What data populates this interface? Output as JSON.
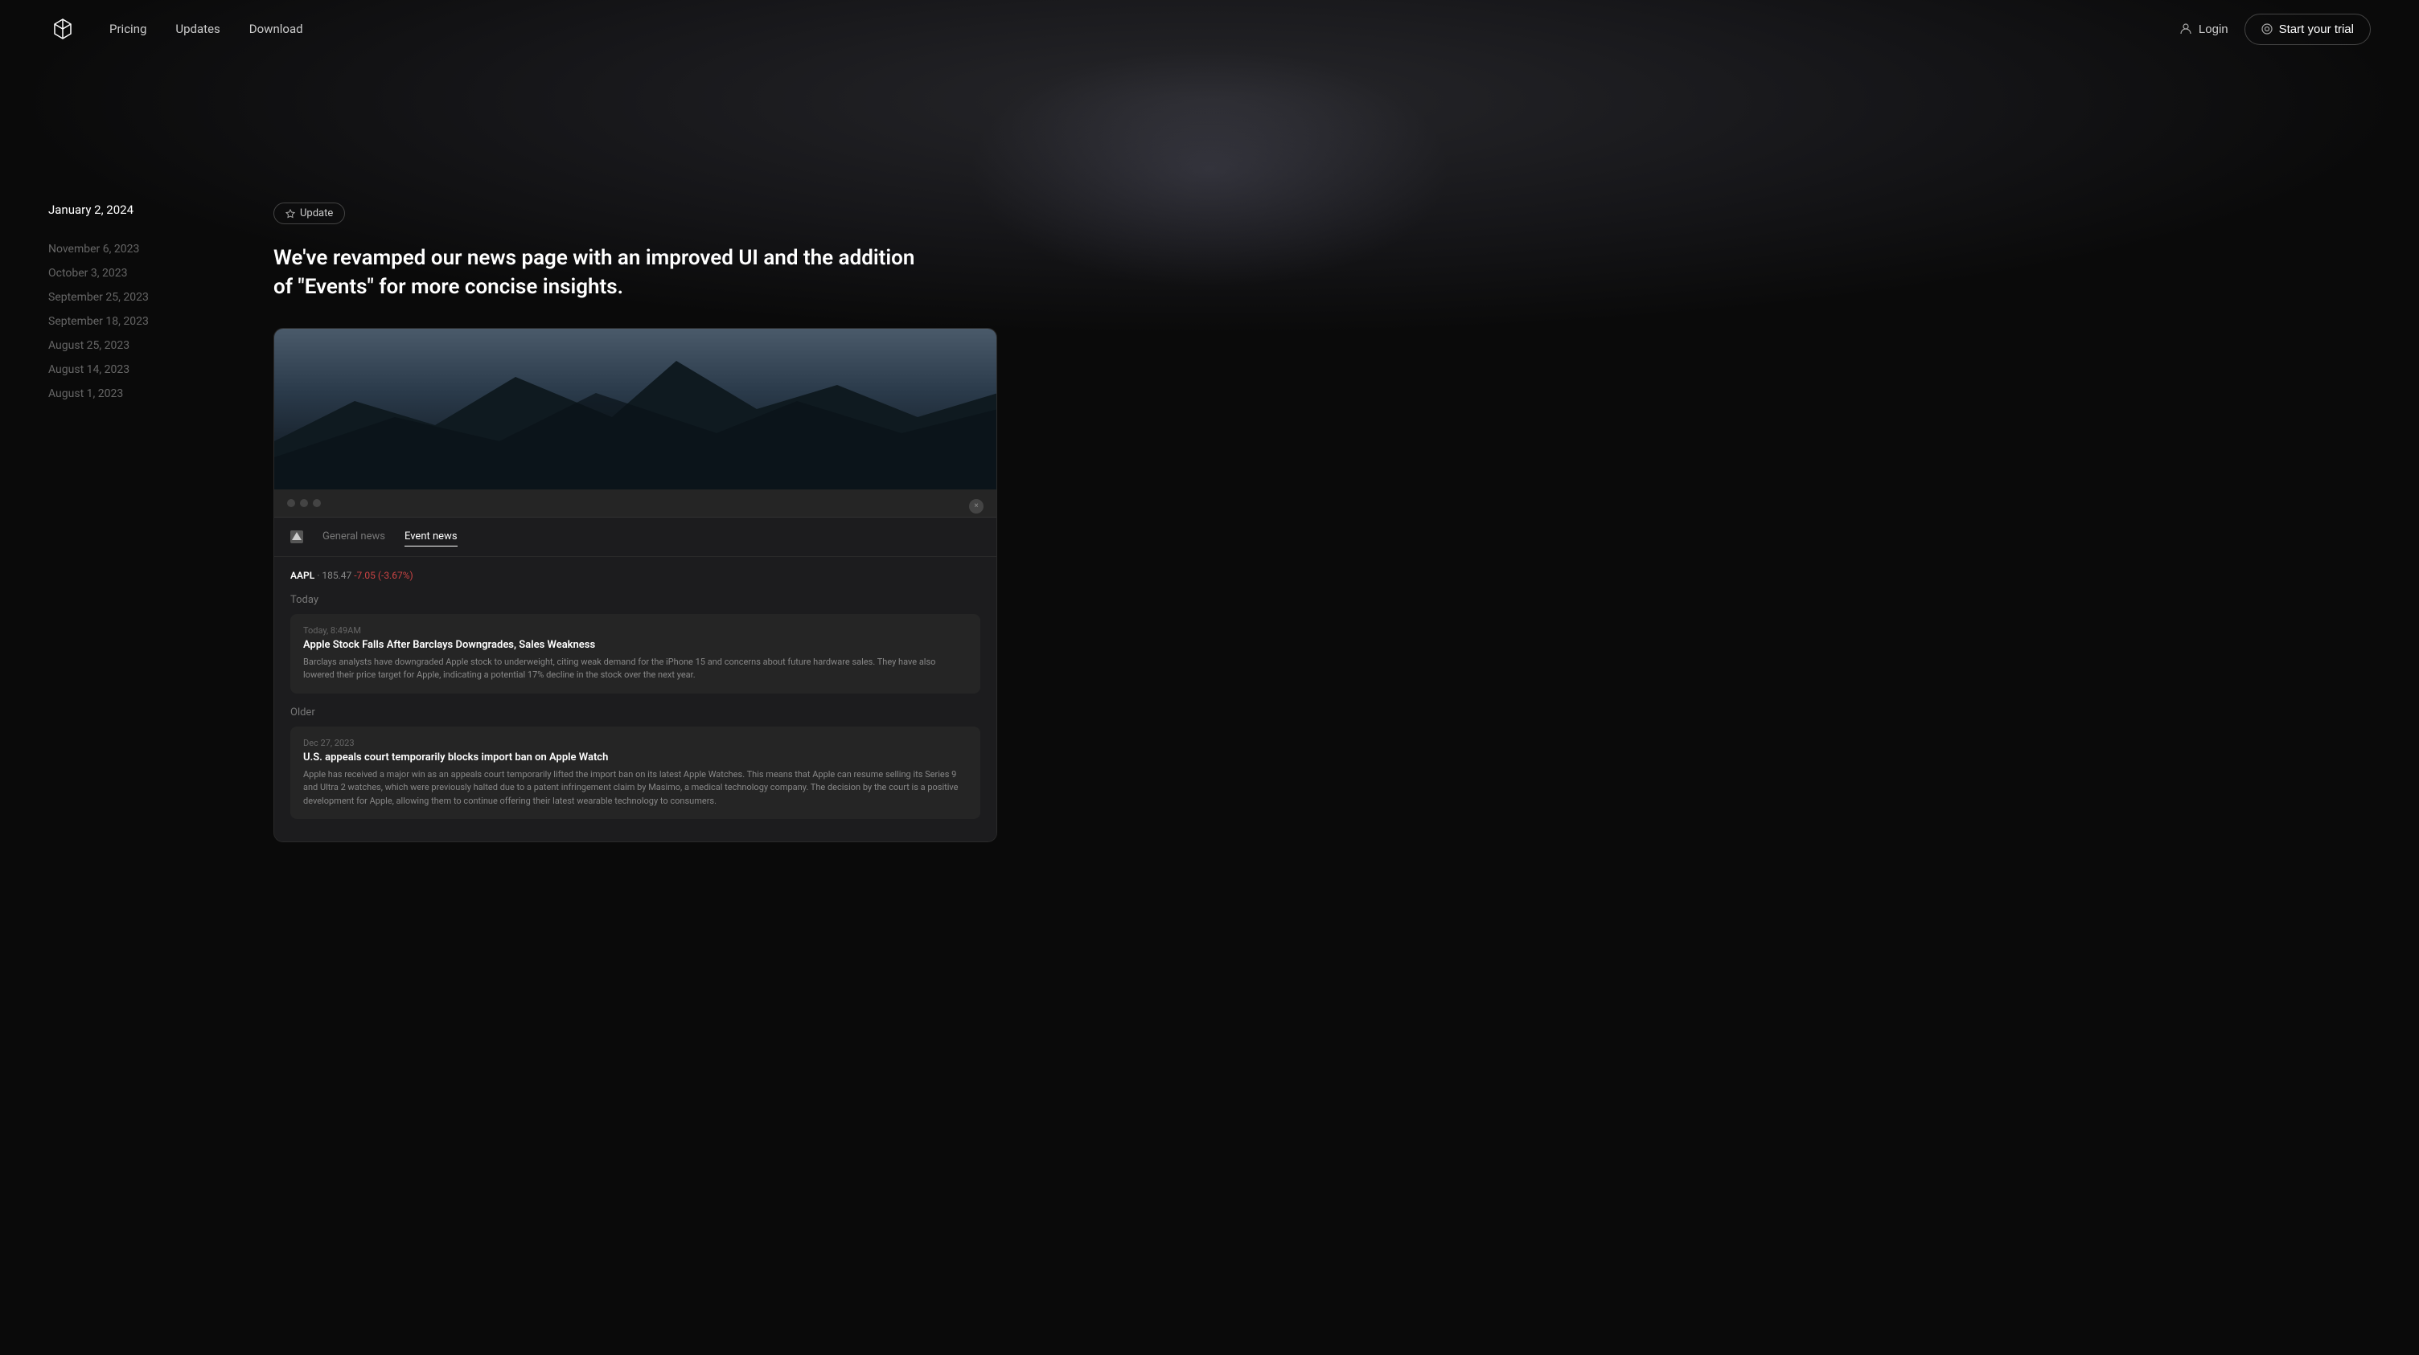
{
  "nav": {
    "pricing_label": "Pricing",
    "updates_label": "Updates",
    "download_label": "Download",
    "login_label": "Login",
    "trial_label": "Start your trial"
  },
  "sidebar": {
    "current_date": "January 2, 2024",
    "past_dates": [
      "November 6, 2023",
      "October 3, 2023",
      "September 25, 2023",
      "September 18, 2023",
      "August 25, 2023",
      "August 14, 2023",
      "August 1, 2023"
    ]
  },
  "article": {
    "badge_label": "Update",
    "title": "We've revamped our news page with an improved UI and the addition of \"Events\" for more concise insights.",
    "app_tabs": {
      "general": "General news",
      "events": "Event news"
    },
    "ticker": {
      "symbol": "AAPL",
      "price": "185.47",
      "change": "-7.05 (-3.67%)"
    },
    "section_today": "Today",
    "news_today": {
      "time": "Today, 8:49AM",
      "title": "Apple Stock Falls After Barclays Downgrades, Sales Weakness",
      "body": "Barclays analysts have downgraded Apple stock to underweight, citing weak demand for the iPhone 15 and concerns about future hardware sales. They have also lowered their price target for Apple, indicating a potential 17% decline in the stock over the next year."
    },
    "section_older": "Older",
    "news_older": {
      "date": "Dec 27, 2023",
      "title": "U.S. appeals court temporarily blocks import ban on Apple Watch",
      "body": "Apple has received a major win as an appeals court temporarily lifted the import ban on its latest Apple Watches. This means that Apple can resume selling its Series 9 and Ultra 2 watches, which were previously halted due to a patent infringement claim by Masimo, a medical technology company. The decision by the court is a positive development for Apple, allowing them to continue offering their latest wearable technology to consumers."
    }
  }
}
